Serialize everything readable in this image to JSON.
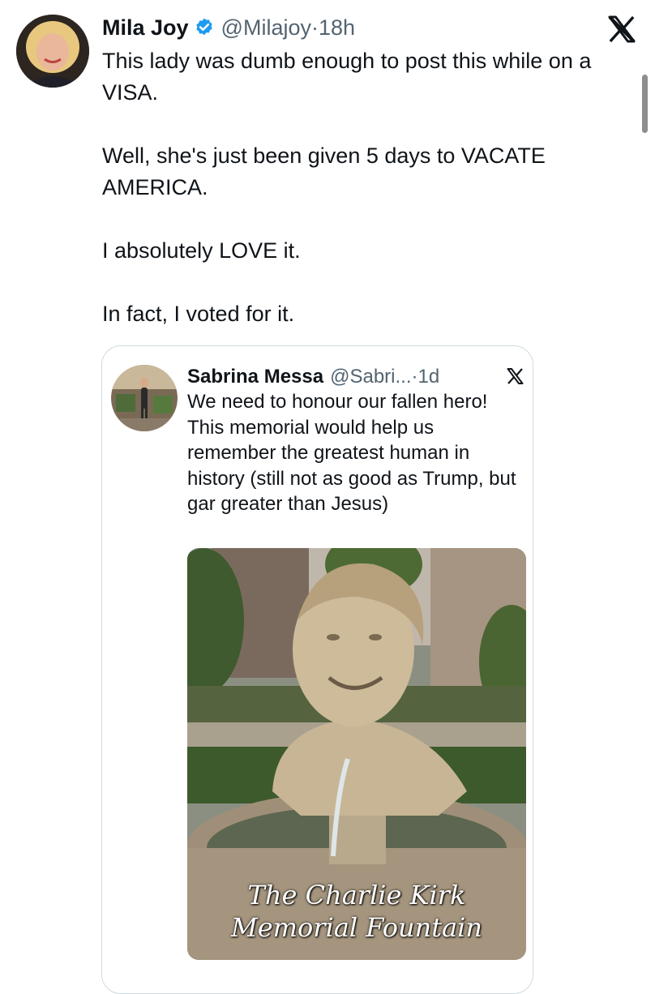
{
  "tweet": {
    "author_name": "Mila Joy",
    "handle": "@Milajoy",
    "separator": "·",
    "time": "18h",
    "paragraphs": [
      "This lady was dumb enough to post this while on a VISA.",
      "Well, she's just been given 5 days to VACATE AMERICA.",
      "I absolutely LOVE it.",
      "In fact, I voted for it."
    ]
  },
  "quoted_tweet": {
    "author_name": "Sabrina Messa",
    "handle": "@Sabri...",
    "separator": "·",
    "time": "1d",
    "text": "We need to honour our fallen hero! This memorial would help us remember the greatest human in history (still not as good as Trump, but gar greater than Jesus)",
    "media_caption_line1": "The Charlie Kirk",
    "media_caption_line2": "Memorial Fountain"
  },
  "icons": {
    "verified": "verified-badge-icon",
    "platform": "x-logo-icon"
  },
  "colors": {
    "text": "#0f1419",
    "secondary": "#536471",
    "verified": "#1d9bf0",
    "border": "#cfd9de"
  }
}
